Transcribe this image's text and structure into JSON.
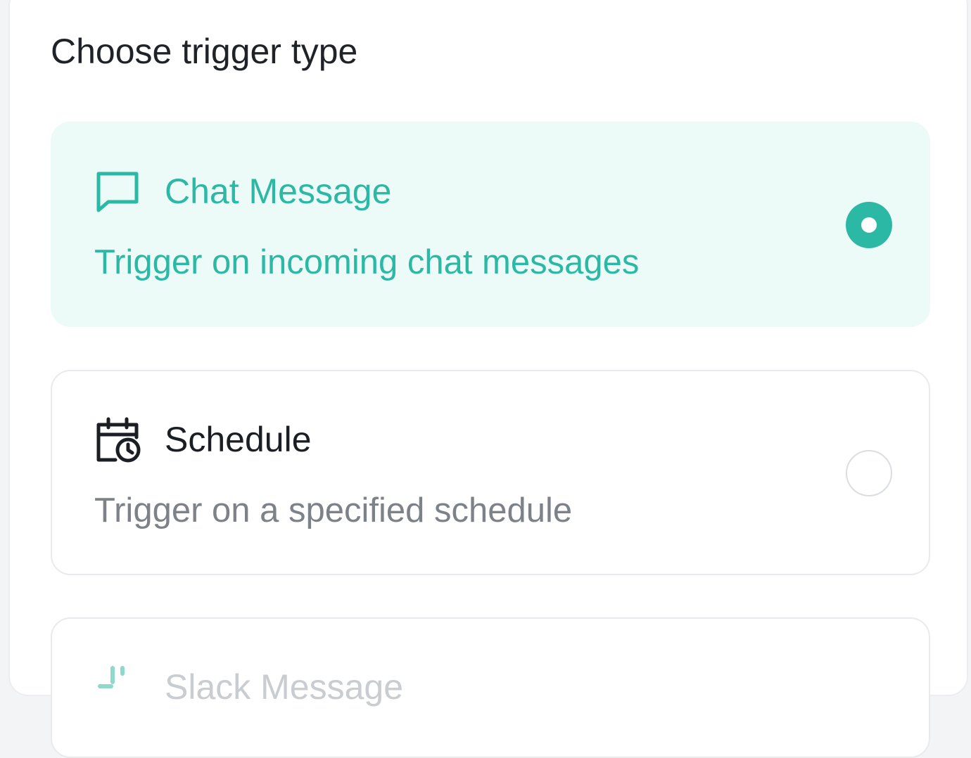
{
  "heading": "Choose trigger type",
  "colors": {
    "accent": "#2bb9a5",
    "selected_bg": "#edfbf8",
    "muted_text": "#7d8288",
    "border": "#e8eaed"
  },
  "options": [
    {
      "icon": "chat-bubble-icon",
      "title": "Chat Message",
      "description": "Trigger on incoming chat messages",
      "selected": true
    },
    {
      "icon": "calendar-clock-icon",
      "title": "Schedule",
      "description": "Trigger on a specified schedule",
      "selected": false
    },
    {
      "icon": "slack-icon",
      "title": "Slack Message",
      "selected": false
    }
  ]
}
